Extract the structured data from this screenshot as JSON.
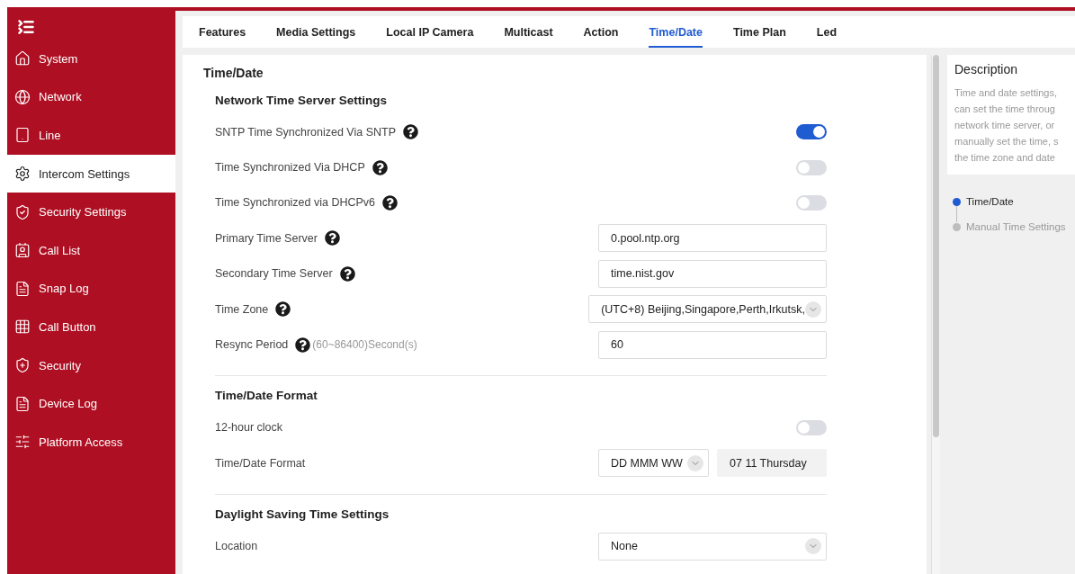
{
  "sidebar": {
    "items": [
      {
        "label": "System",
        "selected": false
      },
      {
        "label": "Network",
        "selected": false
      },
      {
        "label": "Line",
        "selected": false
      },
      {
        "label": "Intercom Settings",
        "selected": true
      },
      {
        "label": "Security Settings",
        "selected": false
      },
      {
        "label": "Call List",
        "selected": false
      },
      {
        "label": "Snap Log",
        "selected": false
      },
      {
        "label": "Call Button",
        "selected": false
      },
      {
        "label": "Security",
        "selected": false
      },
      {
        "label": "Device Log",
        "selected": false
      },
      {
        "label": "Platform Access",
        "selected": false
      }
    ]
  },
  "tabs": [
    {
      "label": "Features",
      "selected": false
    },
    {
      "label": "Media Settings",
      "selected": false
    },
    {
      "label": "Local IP Camera",
      "selected": false
    },
    {
      "label": "Multicast",
      "selected": false
    },
    {
      "label": "Action",
      "selected": false
    },
    {
      "label": "Time/Date",
      "selected": true
    },
    {
      "label": "Time Plan",
      "selected": false
    },
    {
      "label": "Led",
      "selected": false
    }
  ],
  "page_title": "Time/Date",
  "sections": [
    {
      "title": "Network Time Server Settings",
      "rows": [
        {
          "kind": "toggle",
          "label": "SNTP Time Synchronized Via SNTP",
          "help": true,
          "on": true
        },
        {
          "kind": "toggle",
          "label": "Time Synchronized Via DHCP",
          "help": true,
          "on": false
        },
        {
          "kind": "toggle",
          "label": "Time Synchronized via DHCPv6",
          "help": true,
          "on": false
        },
        {
          "kind": "text",
          "label": "Primary Time Server",
          "help": true,
          "value": "0.pool.ntp.org"
        },
        {
          "kind": "text",
          "label": "Secondary Time Server",
          "help": true,
          "value": "time.nist.gov"
        },
        {
          "kind": "select",
          "label": "Time Zone",
          "help": true,
          "value": "(UTC+8) Beijing,Singapore,Perth,Irkutsk,"
        },
        {
          "kind": "text",
          "label": "Resync Period",
          "help": true,
          "hint": "(60~86400)Second(s)",
          "value": "60"
        }
      ]
    },
    {
      "title": "Time/Date Format",
      "rows": [
        {
          "kind": "toggle",
          "label": "12-hour clock",
          "help": false,
          "on": false
        },
        {
          "kind": "format",
          "label": "Time/Date Format",
          "help": false,
          "value": "DD MMM WW",
          "preview": "07 11 Thursday"
        }
      ]
    },
    {
      "title": "Daylight Saving Time Settings",
      "rows": [
        {
          "kind": "select",
          "label": "Location",
          "help": false,
          "value": "None"
        }
      ]
    }
  ],
  "description": {
    "title": "Description",
    "lines": [
      "Time and date settings,",
      "can set the time throug",
      "network time server, or",
      "manually set the time, s",
      "the time zone and date"
    ]
  },
  "steps": [
    {
      "label": "Time/Date",
      "selected": true
    },
    {
      "label": "Manual Time Settings",
      "selected": false
    }
  ]
}
